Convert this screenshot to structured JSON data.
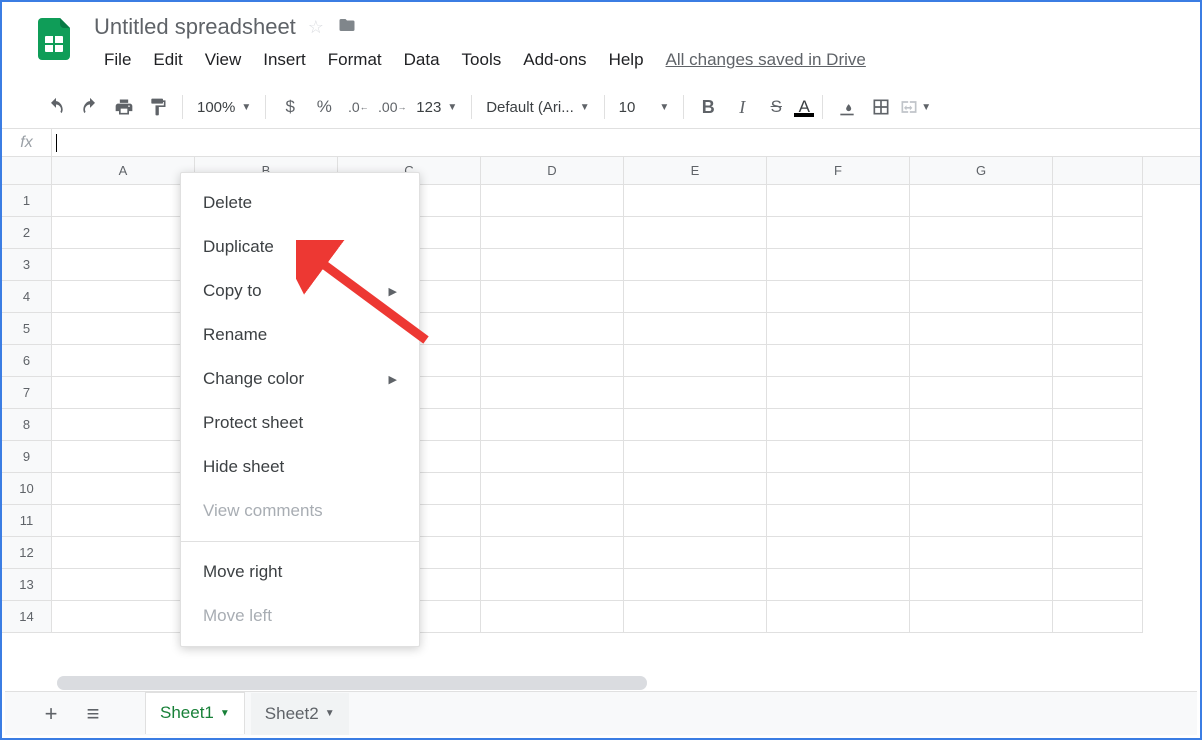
{
  "header": {
    "title": "Untitled spreadsheet",
    "saved_text": "All changes saved in Drive",
    "menu": [
      "File",
      "Edit",
      "View",
      "Insert",
      "Format",
      "Data",
      "Tools",
      "Add-ons",
      "Help"
    ]
  },
  "toolbar": {
    "zoom": "100%",
    "currency": "$",
    "percent": "%",
    "number_format": "123",
    "font": "Default (Ari...",
    "font_size": "10"
  },
  "formula_bar": {
    "label": "fx",
    "value": ""
  },
  "grid": {
    "columns": [
      "A",
      "B",
      "C",
      "D",
      "E",
      "F",
      "G"
    ],
    "rows": [
      1,
      2,
      3,
      4,
      5,
      6,
      7,
      8,
      9,
      10,
      11,
      12,
      13,
      14
    ]
  },
  "sheet_tabs": {
    "active": "Sheet1",
    "tabs": [
      "Sheet1",
      "Sheet2"
    ]
  },
  "context_menu": [
    {
      "label": "Delete",
      "enabled": true
    },
    {
      "label": "Duplicate",
      "enabled": true
    },
    {
      "label": "Copy to",
      "enabled": true,
      "submenu": true
    },
    {
      "label": "Rename",
      "enabled": true
    },
    {
      "label": "Change color",
      "enabled": true,
      "submenu": true
    },
    {
      "label": "Protect sheet",
      "enabled": true
    },
    {
      "label": "Hide sheet",
      "enabled": true
    },
    {
      "label": "View comments",
      "enabled": false
    },
    {
      "sep": true
    },
    {
      "label": "Move right",
      "enabled": true
    },
    {
      "label": "Move left",
      "enabled": false
    }
  ]
}
